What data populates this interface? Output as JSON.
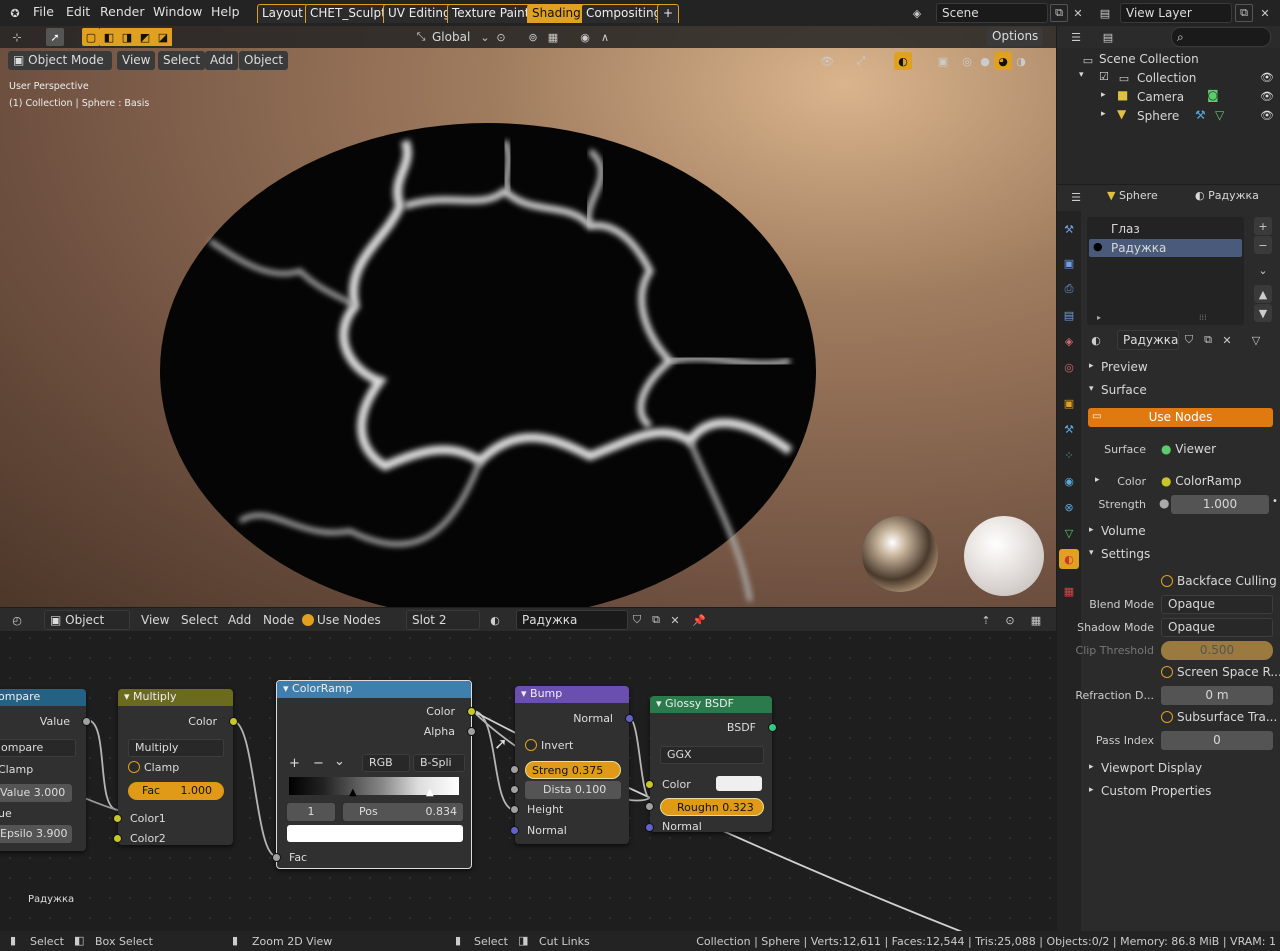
{
  "topbar": {
    "menus": [
      "File",
      "Edit",
      "Render",
      "Window",
      "Help"
    ],
    "workspaces": [
      "Layout",
      "CHET_Sculpt",
      "UV Editing",
      "Texture Paint",
      "Shading",
      "Compositing"
    ],
    "active_workspace": "Shading",
    "add_tab": "+",
    "scene": "Scene",
    "view_layer": "View Layer"
  },
  "viewport_header": {
    "transform_orientation": "Global",
    "options": "Options",
    "mode": "Object Mode",
    "menus": [
      "View",
      "Select",
      "Add",
      "Object"
    ]
  },
  "viewport": {
    "overlay_line1": "User Perspective",
    "overlay_line2": "(1) Collection | Sphere : Basis"
  },
  "node_header": {
    "editor_type": "Object",
    "menus": [
      "View",
      "Select",
      "Add",
      "Node"
    ],
    "use_nodes": "Use Nodes",
    "slot": "Slot 2",
    "material": "Радужка"
  },
  "nodes": {
    "compare": {
      "title": "ompare",
      "output": "Value",
      "operation": "ompare",
      "clamp": "Clamp",
      "value_label": "Value",
      "value": "3.000",
      "ue": "ue",
      "epsilon_label": "Epsilo",
      "epsilon": "3.900"
    },
    "multiply": {
      "title": "Multiply",
      "output": "Color",
      "blend": "Multiply",
      "clamp": "Clamp",
      "fac_label": "Fac",
      "fac": "1.000",
      "in1": "Color1",
      "in2": "Color2"
    },
    "colorramp": {
      "title": "ColorRamp",
      "out_color": "Color",
      "out_alpha": "Alpha",
      "add": "+",
      "remove": "−",
      "menu": "⌄",
      "mode": "RGB",
      "interp": "B-Spli",
      "index": "1",
      "pos_label": "Pos",
      "pos": "0.834",
      "fac": "Fac"
    },
    "bump": {
      "title": "Bump",
      "out_normal": "Normal",
      "invert": "Invert",
      "strength_label": "Streng",
      "strength": "0.375",
      "distance_label": "Dista",
      "distance": "0.100",
      "height": "Height",
      "normal": "Normal"
    },
    "glossy": {
      "title": "Glossy BSDF",
      "out_bsdf": "BSDF",
      "distribution": "GGX",
      "color": "Color",
      "roughness_label": "Roughn",
      "roughness": "0.323",
      "normal": "Normal"
    },
    "frame_label": "Радужка"
  },
  "outliner": {
    "scene_collection": "Scene Collection",
    "items": [
      {
        "label": "Collection"
      },
      {
        "label": "Camera"
      },
      {
        "label": "Sphere"
      }
    ]
  },
  "properties": {
    "object_tab": "Sphere",
    "material_tab": "Радужка",
    "slots": [
      "Глаз",
      "Радужка"
    ],
    "material_name": "Радужка",
    "preview": "Preview",
    "surface_panel": "Surface",
    "use_nodes_button": "Use Nodes",
    "surface_label": "Surface",
    "surface_value": "Viewer",
    "color_label": "Color",
    "color_value": "ColorRamp",
    "strength_label": "Strength",
    "strength_value": "1.000",
    "volume": "Volume",
    "settings": "Settings",
    "backface_culling": "Backface Culling",
    "blend_mode_label": "Blend Mode",
    "blend_mode": "Opaque",
    "shadow_mode_label": "Shadow Mode",
    "shadow_mode": "Opaque",
    "clip_threshold_label": "Clip Threshold",
    "clip_threshold": "0.500",
    "screen_space": "Screen Space R...",
    "refraction_label": "Refraction D...",
    "refraction_value": "0 m",
    "subsurface": "Subsurface Tra...",
    "pass_index_label": "Pass Index",
    "pass_index": "0",
    "viewport_display": "Viewport Display",
    "custom_properties": "Custom Properties"
  },
  "statusbar": {
    "select": "Select",
    "box_select": "Box Select",
    "zoom": "Zoom 2D View",
    "select2": "Select",
    "cut_links": "Cut Links",
    "stats": "Collection | Sphere | Verts:12,611 | Faces:12,544 | Tris:25,088 | Objects:0/2 | Memory: 86.8 MiB | VRAM: 1"
  },
  "colors": {
    "accent": "#e0a020",
    "node_compare": "#246283",
    "node_multiply": "#6b6b1f",
    "node_colorramp": "#3f7fae",
    "node_bump": "#6a4fb0",
    "node_glossy": "#2a7a4b"
  }
}
